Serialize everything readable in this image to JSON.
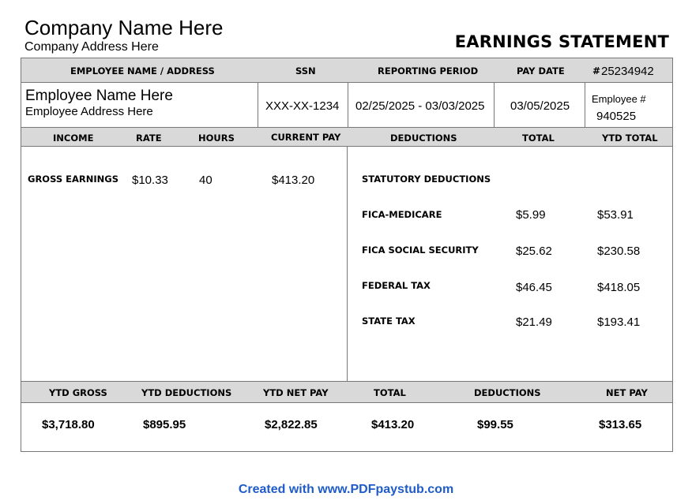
{
  "header": {
    "company_name": "Company Name Here",
    "company_address": "Company Address Here",
    "statement_title": "EARNINGS STATEMENT"
  },
  "info_headers": {
    "employee": "EMPLOYEE NAME / ADDRESS",
    "ssn": "SSN",
    "period": "REPORTING PERIOD",
    "pay_date": "PAY DATE",
    "check_prefix": "#",
    "check_number": "25234942"
  },
  "info_values": {
    "employee_name": "Employee Name Here",
    "employee_address": "Employee Address Here",
    "ssn": "XXX-XX-1234",
    "period": "02/25/2025 - 03/03/2025",
    "pay_date": "03/05/2025",
    "employee_no_label": "Employee #",
    "employee_no": "940525"
  },
  "earnings_headers": {
    "income": "INCOME",
    "rate": "RATE",
    "hours": "HOURS",
    "current_pay": "CURRENT PAY",
    "deductions": "DEDUCTIONS",
    "total": "TOTAL",
    "ytd_total": "YTD TOTAL"
  },
  "earnings": {
    "label": "GROSS EARNINGS",
    "rate": "$10.33",
    "hours": "40",
    "current_pay": "$413.20"
  },
  "deductions": {
    "section_label": "STATUTORY DEDUCTIONS",
    "items": [
      {
        "label": "FICA-MEDICARE",
        "total": "$5.99",
        "ytd": "$53.91"
      },
      {
        "label": "FICA SOCIAL SECURITY",
        "total": "$25.62",
        "ytd": "$230.58"
      },
      {
        "label": "FEDERAL TAX",
        "total": "$46.45",
        "ytd": "$418.05"
      },
      {
        "label": "STATE TAX",
        "total": "$21.49",
        "ytd": "$193.41"
      }
    ]
  },
  "summary_headers": {
    "ytd_gross": "YTD GROSS",
    "ytd_deductions": "YTD DEDUCTIONS",
    "ytd_net_pay": "YTD NET PAY",
    "total": "TOTAL",
    "deductions": "DEDUCTIONS",
    "net_pay": "NET PAY"
  },
  "summary_values": {
    "ytd_gross": "$3,718.80",
    "ytd_deductions": "$895.95",
    "ytd_net_pay": "$2,822.85",
    "total": "$413.20",
    "deductions": "$99.55",
    "net_pay": "$313.65"
  },
  "footer": {
    "text": "Created with www.PDFpaystub.com"
  },
  "colors": {
    "header_bar": "#d9d9d9",
    "border": "#777777",
    "footer_link": "#1f5cc9"
  }
}
